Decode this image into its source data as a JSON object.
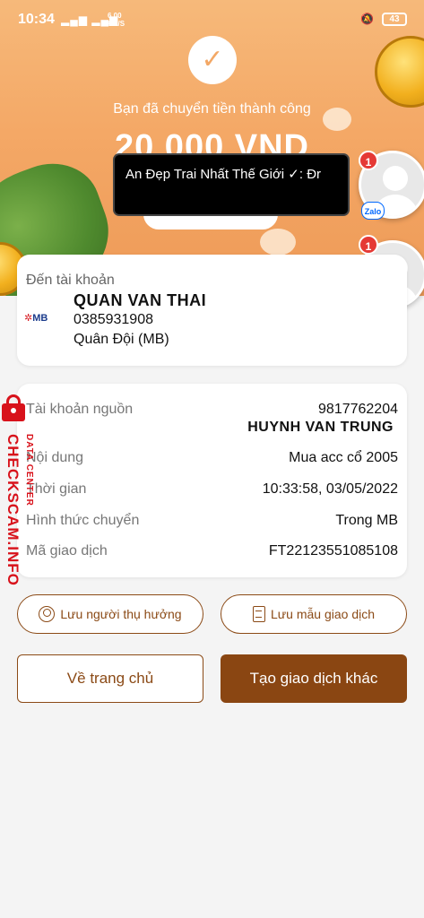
{
  "status_bar": {
    "time": "10:34",
    "signal": "4G",
    "speed": "6.00\nKB/S",
    "battery": "43"
  },
  "header": {
    "success_text": "Bạn đã chuyển tiền thành công",
    "amount": "20 000 VND"
  },
  "chat_bubble": {
    "message": "An Đẹp Trai Nhất Thế Giới ✓: Đr",
    "zalo_label": "Zalo",
    "badge1": "1",
    "badge2": "1"
  },
  "recipient": {
    "label": "Đến tài khoản",
    "bank_logo": "MB",
    "name": "QUAN VAN THAI",
    "account": "0385931908",
    "bank": "Quân Đội (MB)"
  },
  "details": {
    "source_label": "Tài khoản nguồn",
    "source_account": "9817762204",
    "source_owner": "HUYNH VAN TRUNG",
    "content_label": "Nội dung",
    "content_value": "Mua acc cổ 2005",
    "time_label": "Thời gian",
    "time_value": "10:33:58, 03/05/2022",
    "method_label": "Hình thức chuyển",
    "method_value": "Trong MB",
    "txid_label": "Mã giao dịch",
    "txid_value": "FT22123551085108"
  },
  "actions": {
    "save_beneficiary": "Lưu người thụ hưởng",
    "save_template": "Lưu mẫu giao dịch",
    "home": "Về trang chủ",
    "new_transaction": "Tạo giao dịch khác"
  },
  "watermark": {
    "brand": "CHECKSCAM.INFO",
    "sub": "DATA CENTER"
  },
  "colors": {
    "accent": "#8a4612",
    "hero": "#f4a866",
    "watermark": "#d8121b"
  }
}
